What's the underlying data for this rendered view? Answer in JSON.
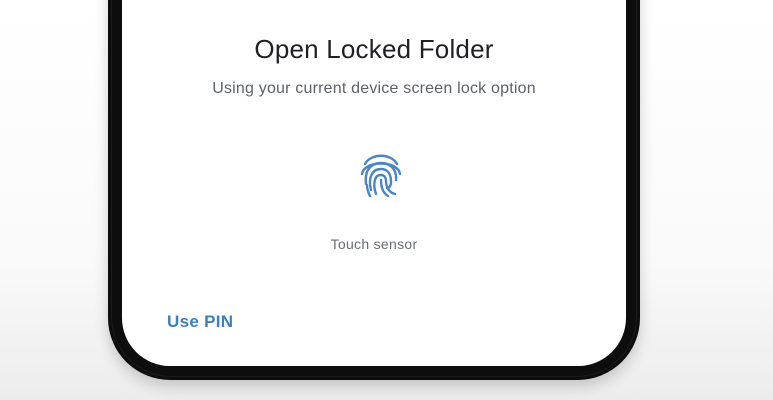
{
  "dialog": {
    "title": "Open Locked Folder",
    "subtitle": "Using your current device screen lock option"
  },
  "sensor": {
    "icon": "fingerprint-icon",
    "label": "Touch sensor",
    "color": "#4a86c5"
  },
  "actions": {
    "use_pin_label": "Use PIN",
    "accent_color": "#3d7fbf"
  }
}
